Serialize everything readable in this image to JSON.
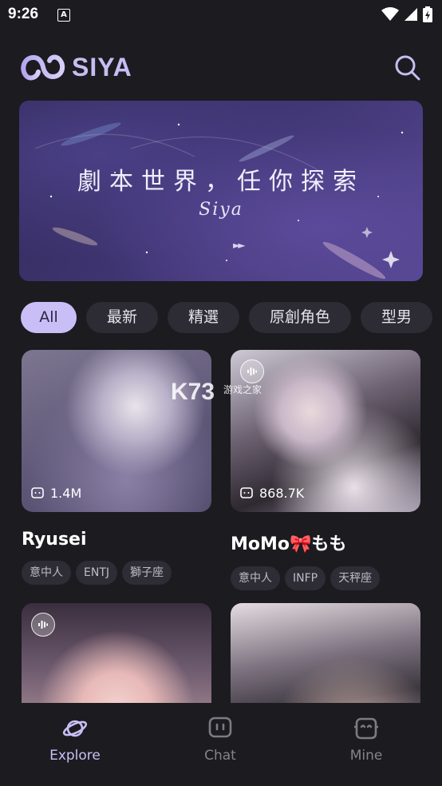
{
  "status": {
    "time": "9:26",
    "a_icon": "A"
  },
  "header": {
    "logo_text": "SIYA"
  },
  "banner": {
    "title": "劇本世界，任你探索",
    "subtitle": "Siya",
    "play_glyph": "►►"
  },
  "chips": [
    {
      "label": "All",
      "active": true
    },
    {
      "label": "最新",
      "active": false
    },
    {
      "label": "精選",
      "active": false
    },
    {
      "label": "原創角色",
      "active": false
    },
    {
      "label": "型男",
      "active": false
    }
  ],
  "cards": [
    {
      "name": "Ryusei",
      "count": "1.4M",
      "tags": [
        "意中人",
        "ENTJ",
        "獅子座"
      ],
      "voice": false
    },
    {
      "name": "MoMo🎀もも",
      "count": "868.7K",
      "tags": [
        "意中人",
        "INFP",
        "天秤座"
      ],
      "voice": true
    },
    {
      "voice": true
    },
    {
      "voice": false
    }
  ],
  "watermark": {
    "brand": "K73",
    "sub": "游戏之家"
  },
  "nav": [
    {
      "label": "Explore",
      "active": true,
      "icon": "planet-icon"
    },
    {
      "label": "Chat",
      "active": false,
      "icon": "chat-icon"
    },
    {
      "label": "Mine",
      "active": false,
      "icon": "mine-face-icon"
    }
  ],
  "colors": {
    "accent": "#c9bff6",
    "background": "#1c1b20",
    "chip": "#2d2b33"
  }
}
